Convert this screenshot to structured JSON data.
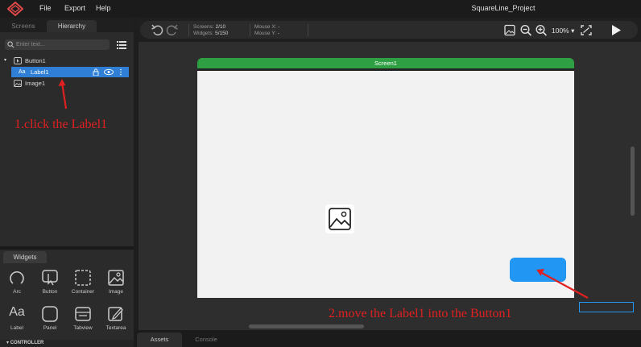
{
  "menubar": {
    "items": [
      "File",
      "Export",
      "Help"
    ],
    "project_title": "SquareLine_Project"
  },
  "left_panel": {
    "tabs": [
      "Screens",
      "Hierarchy"
    ],
    "active_tab": "Hierarchy",
    "search": {
      "placeholder": "Enter text..."
    },
    "tree": [
      {
        "label": "Button1",
        "icon": "button-icon",
        "caret": "▾"
      },
      {
        "label": "Label1",
        "icon": "label-icon",
        "icon_text": "Aa",
        "selected": true
      },
      {
        "label": "Image1",
        "icon": "image-icon"
      }
    ]
  },
  "widgets_panel": {
    "tab_label": "Widgets",
    "items": [
      {
        "label": "Arc",
        "icon": "arc-icon"
      },
      {
        "label": "Button",
        "icon": "button-icon"
      },
      {
        "label": "Container",
        "icon": "container-icon"
      },
      {
        "label": "Image",
        "icon": "image-icon"
      },
      {
        "label": "Label",
        "icon": "label-icon",
        "icon_text": "Aa"
      },
      {
        "label": "Panel",
        "icon": "panel-icon"
      },
      {
        "label": "Tabview",
        "icon": "tabview-icon"
      },
      {
        "label": "Textarea",
        "icon": "textarea-icon"
      }
    ],
    "controller_label": "CONTROLLER"
  },
  "toolbar": {
    "screens_label": "Screens:",
    "screens_value": "2/10",
    "widgets_label": "Widgets:",
    "widgets_value": "5/150",
    "mouse_x_label": "Mouse X:",
    "mouse_x_value": "-",
    "mouse_y_label": "Mouse Y:",
    "mouse_y_value": "-",
    "zoom": "100%",
    "zoom_caret": "▾"
  },
  "canvas": {
    "screen_title": "Screen1"
  },
  "bottom_tabs": [
    "Assets",
    "Console"
  ],
  "annotations": {
    "step1": "1.click the Label1",
    "step2": "2.move the Label1 into the Button1"
  },
  "colors": {
    "selection": "#2f7fd6",
    "screen_header": "#2ea043",
    "button_widget": "#2196f3",
    "annotation": "#e02020"
  }
}
